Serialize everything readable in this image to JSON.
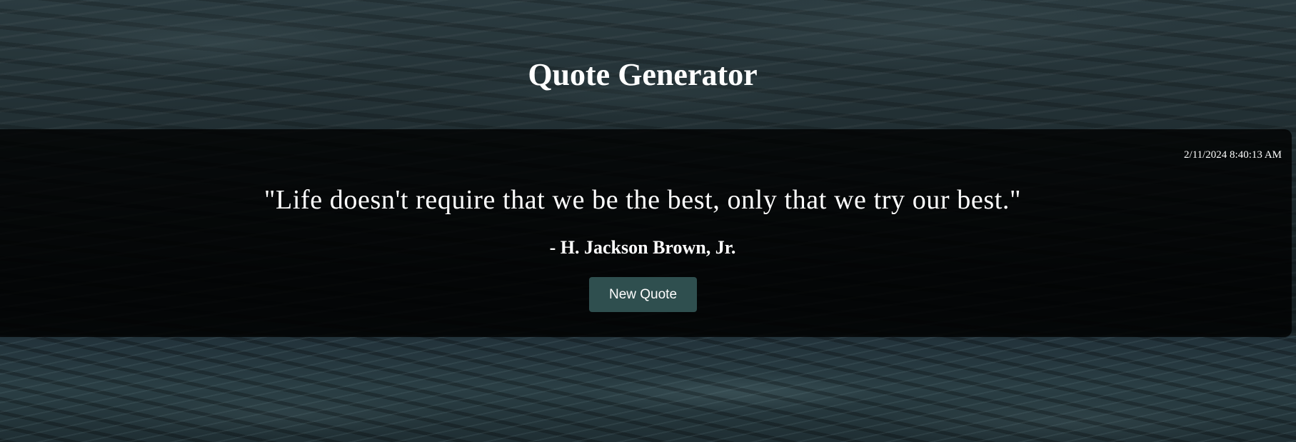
{
  "header": {
    "title": "Quote Generator"
  },
  "quote_card": {
    "timestamp": "2/11/2024 8:40:13 AM",
    "quote_text": "\"Life doesn't require that we be the best, only that we try our best.\"",
    "author": "- H. Jackson Brown, Jr.",
    "new_quote_label": "New Quote"
  },
  "colors": {
    "button_background": "#2f4f4f",
    "card_background": "rgba(0,0,0,0.78)",
    "text": "#ffffff"
  }
}
